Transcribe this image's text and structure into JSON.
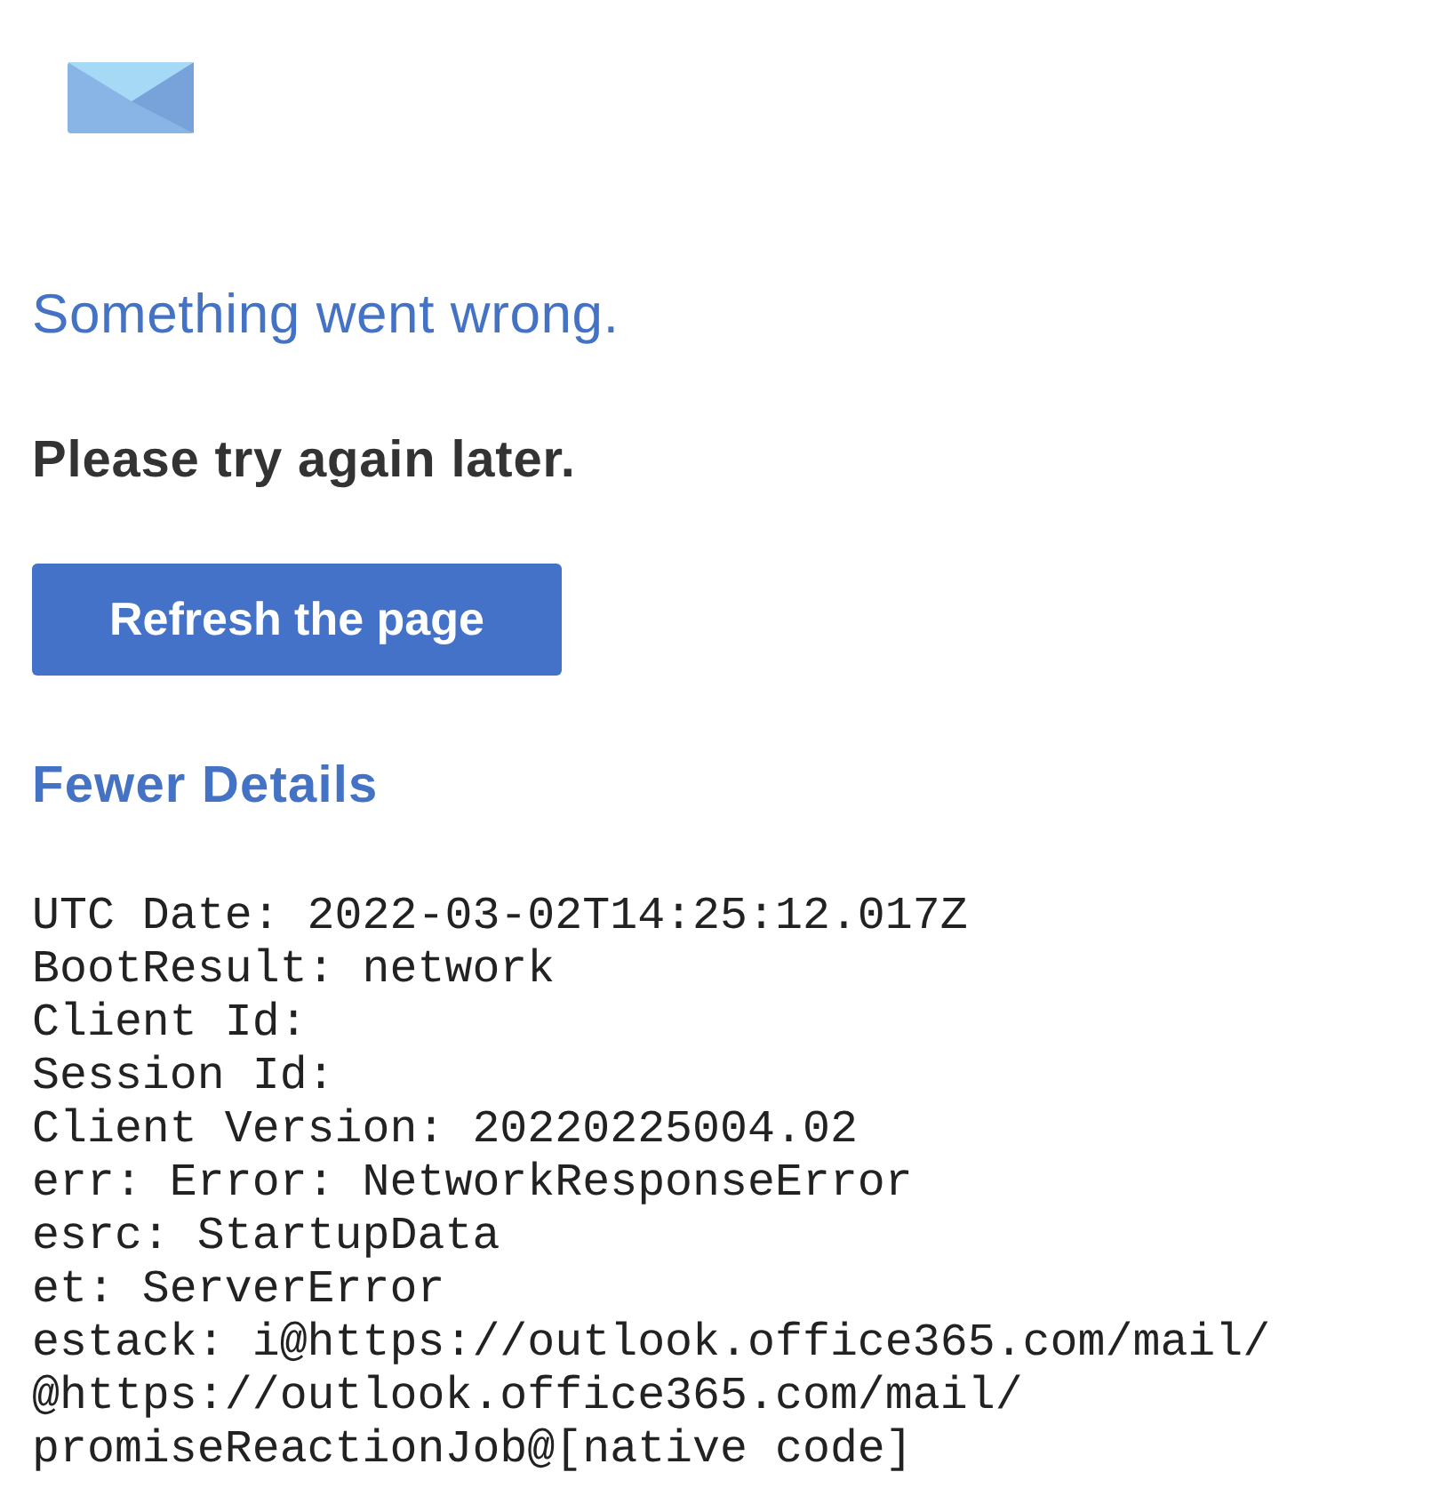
{
  "heading": "Something went wrong.",
  "message": "Please try again later.",
  "refresh_button": {
    "label": "Refresh the page"
  },
  "details_toggle": {
    "label": "Fewer Details"
  },
  "details": {
    "lines": [
      "UTC Date: 2022-03-02T14:25:12.017Z",
      "BootResult: network",
      "Client Id:",
      "Session Id:",
      "Client Version: 20220225004.02",
      "err: Error: NetworkResponseError",
      "esrc: StartupData",
      "et: ServerError",
      "estack: i@https://outlook.office365.com/mail/",
      "@https://outlook.office365.com/mail/",
      "promiseReactionJob@[native code]"
    ]
  }
}
